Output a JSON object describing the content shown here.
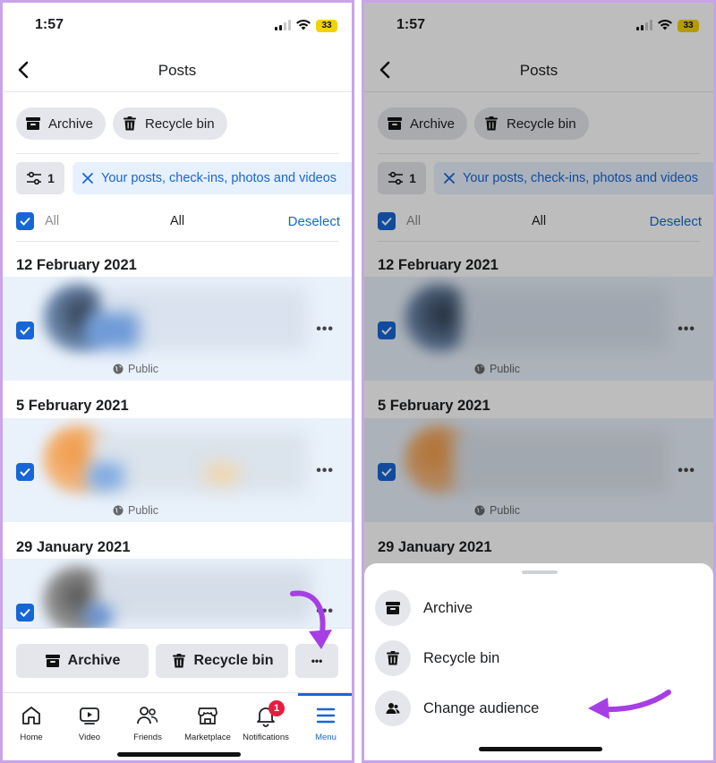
{
  "status": {
    "time": "1:57",
    "battery": "33"
  },
  "header": {
    "title": "Posts"
  },
  "top_actions": {
    "archive": "Archive",
    "recycle_bin": "Recycle bin"
  },
  "filter": {
    "count": "1",
    "chip_text": "Your posts, check-ins, photos and videos"
  },
  "selection": {
    "all_left": "All",
    "all_center": "All",
    "deselect": "Deselect"
  },
  "posts": [
    {
      "date": "12 February 2021",
      "audience": "Public"
    },
    {
      "date": "5 February 2021",
      "audience": "Public"
    },
    {
      "date": "29 January 2021",
      "audience": ""
    }
  ],
  "bottom_actions": {
    "archive": "Archive",
    "recycle_bin": "Recycle bin",
    "more": "•••"
  },
  "tabs": [
    {
      "label": "Home",
      "icon": "home-icon"
    },
    {
      "label": "Video",
      "icon": "video-icon"
    },
    {
      "label": "Friends",
      "icon": "friends-icon"
    },
    {
      "label": "Marketplace",
      "icon": "marketplace-icon"
    },
    {
      "label": "Notifications",
      "icon": "bell-icon",
      "badge": "1"
    },
    {
      "label": "Menu",
      "icon": "menu-icon",
      "active": true
    }
  ],
  "sheet": {
    "items": [
      {
        "label": "Archive",
        "icon": "archive-icon"
      },
      {
        "label": "Recycle bin",
        "icon": "trash-icon"
      },
      {
        "label": "Change audience",
        "icon": "audience-icon"
      }
    ]
  },
  "colors": {
    "accent": "#1766d6",
    "annotation": "#a63ee6",
    "badge": "#e41e3f"
  }
}
